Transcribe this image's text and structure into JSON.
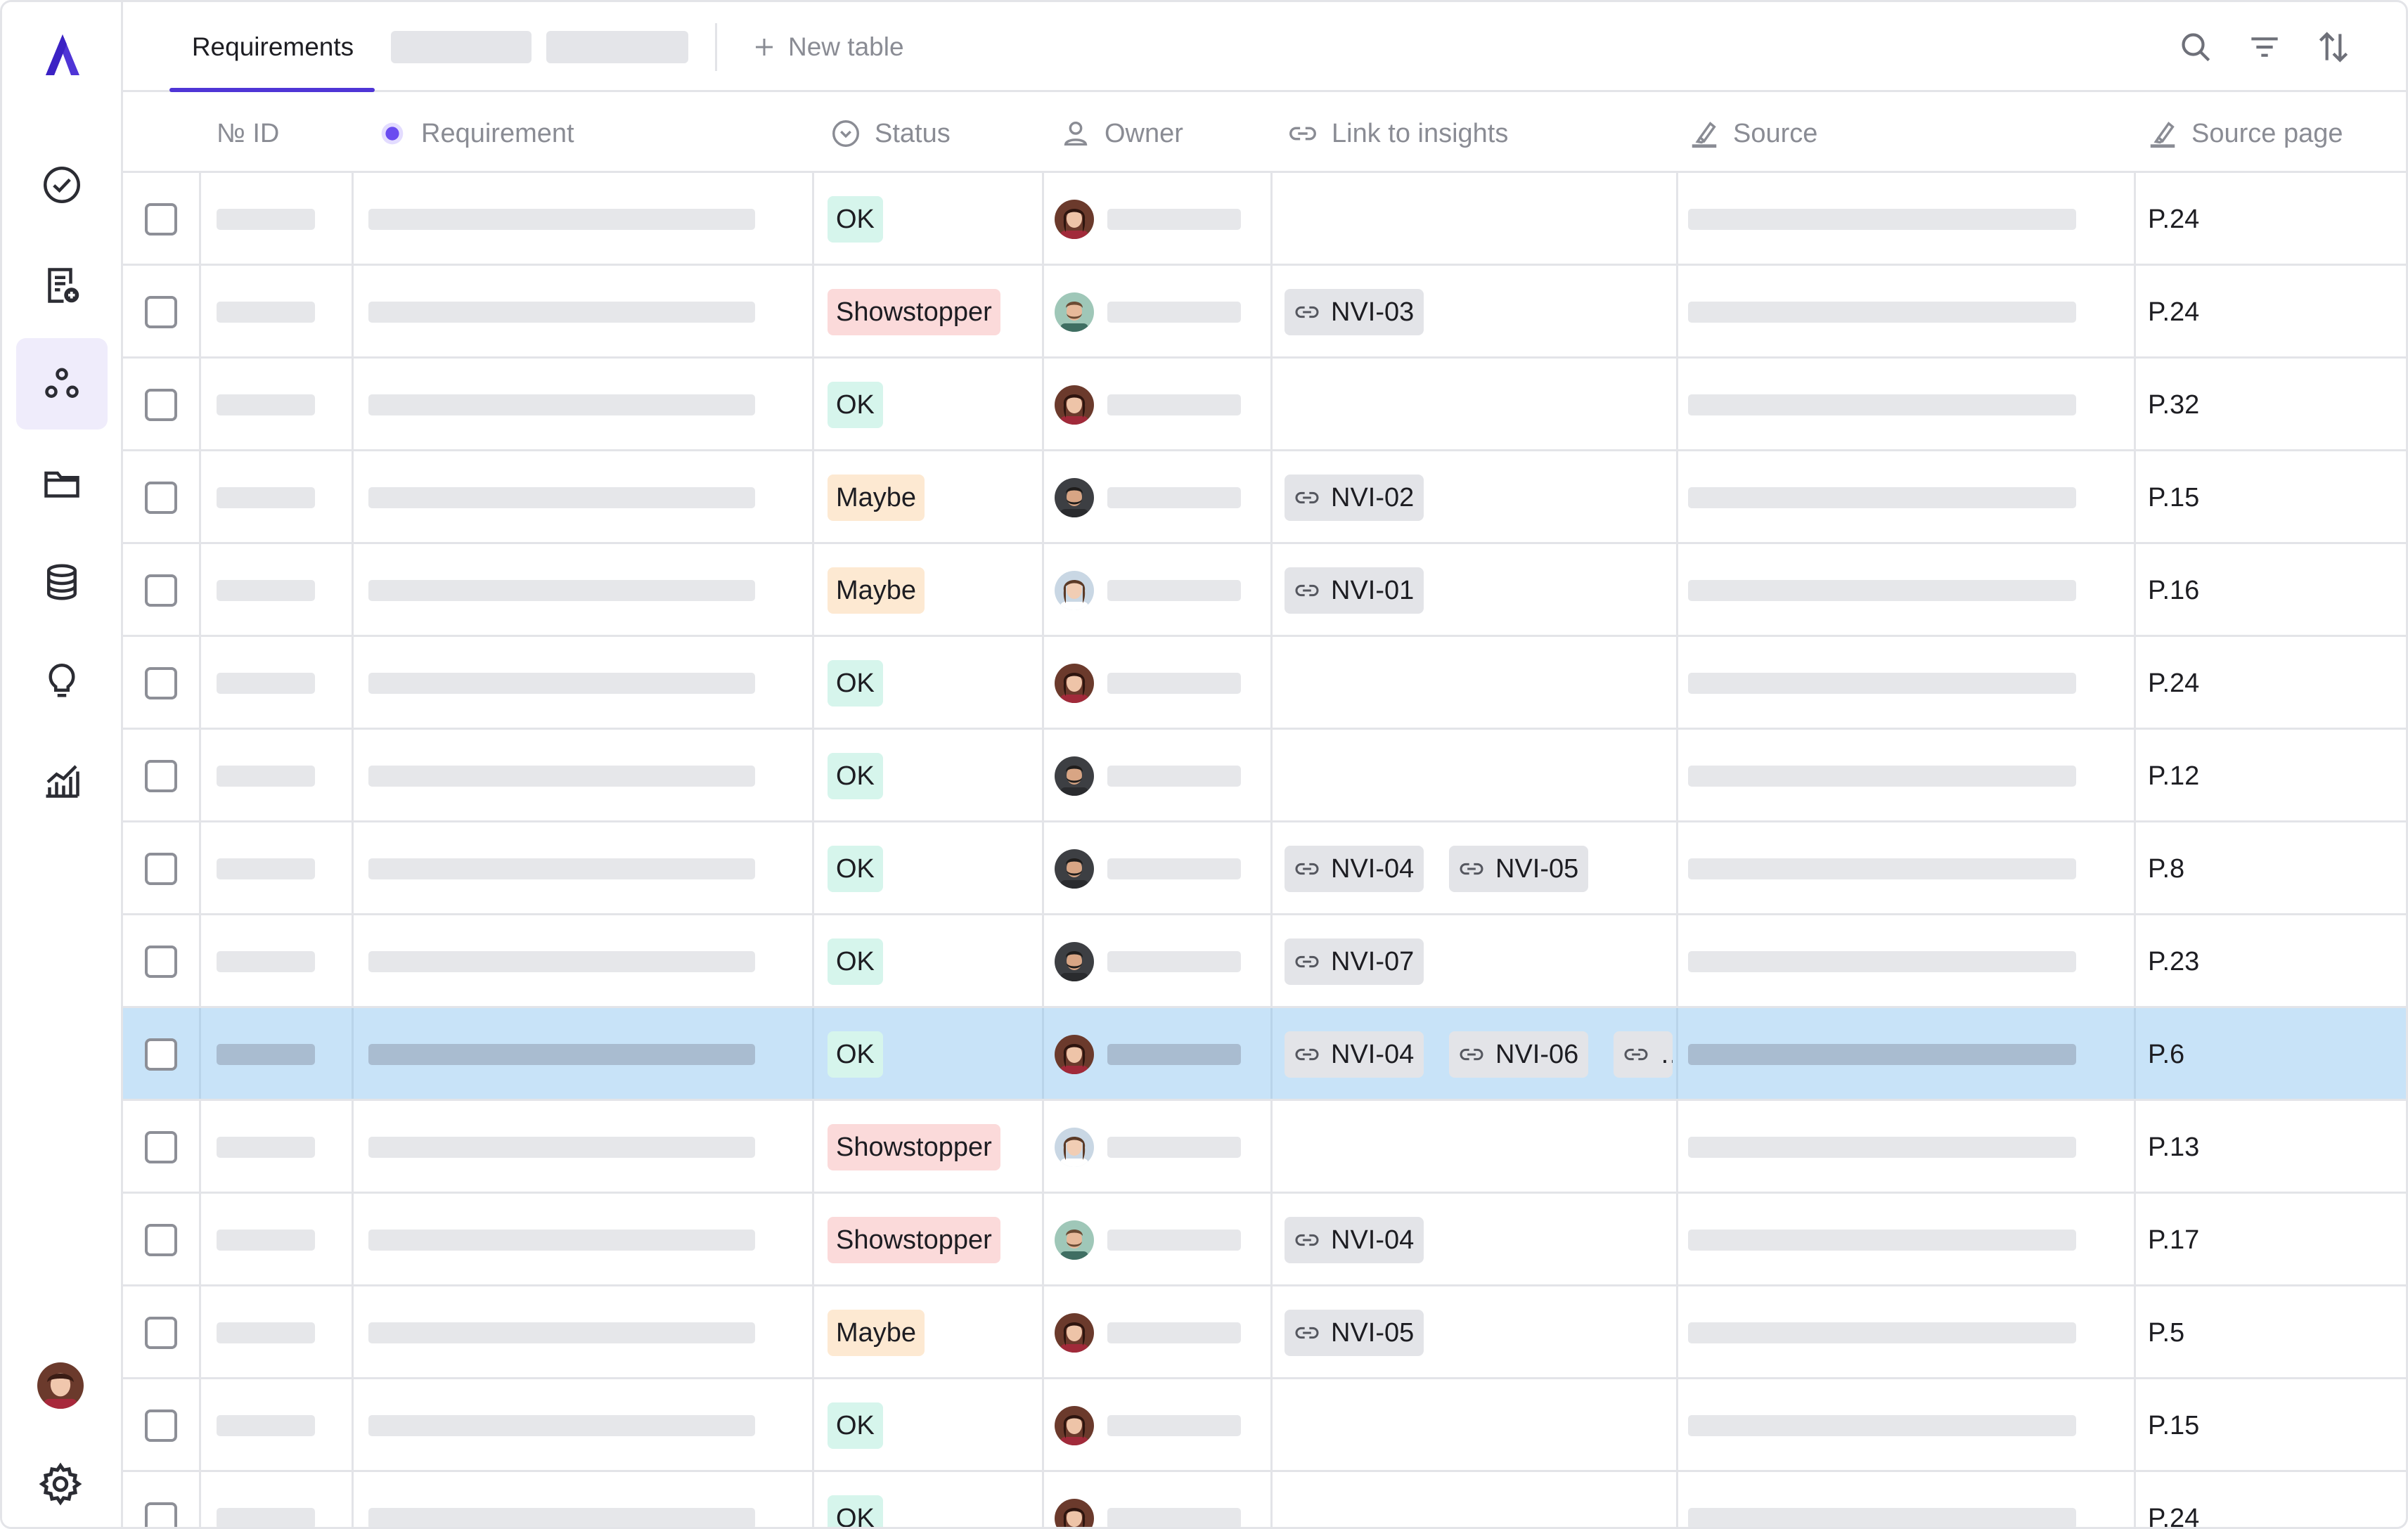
{
  "tabs": {
    "active_label": "Requirements",
    "new_table_label": "New table"
  },
  "columns": {
    "id": "№ ID",
    "requirement": "Requirement",
    "status": "Status",
    "owner": "Owner",
    "link_to_insights": "Link to insights",
    "source": "Source",
    "source_page": "Source page"
  },
  "sidebar": {
    "items": [
      {
        "icon": "check-circle-icon"
      },
      {
        "icon": "document-add-icon"
      },
      {
        "icon": "nodes-icon",
        "active": true
      },
      {
        "icon": "folder-icon"
      },
      {
        "icon": "database-icon"
      },
      {
        "icon": "lightbulb-icon"
      },
      {
        "icon": "analytics-icon"
      }
    ]
  },
  "colors": {
    "accent": "#4f35d6",
    "selected_row": "#c8e3f8",
    "ok": "#d6f5ec",
    "showstopper": "#fbdada",
    "maybe": "#fde9d2"
  },
  "rows": [
    {
      "status": "OK",
      "status_kind": "ok",
      "owner": "woman-dark",
      "insights": [],
      "page": "P.24"
    },
    {
      "status": "Showstopper",
      "status_kind": "showstopper",
      "owner": "man-teal",
      "insights": [
        "NVI-03"
      ],
      "page": "P.24"
    },
    {
      "status": "OK",
      "status_kind": "ok",
      "owner": "woman-dark",
      "insights": [],
      "page": "P.32"
    },
    {
      "status": "Maybe",
      "status_kind": "maybe",
      "owner": "man-beard",
      "insights": [
        "NVI-02"
      ],
      "page": "P.15"
    },
    {
      "status": "Maybe",
      "status_kind": "maybe",
      "owner": "woman-light",
      "insights": [
        "NVI-01"
      ],
      "page": "P.16"
    },
    {
      "status": "OK",
      "status_kind": "ok",
      "owner": "woman-dark",
      "insights": [],
      "page": "P.24"
    },
    {
      "status": "OK",
      "status_kind": "ok",
      "owner": "man-beard",
      "insights": [],
      "page": "P.12"
    },
    {
      "status": "OK",
      "status_kind": "ok",
      "owner": "man-beard",
      "insights": [
        "NVI-04",
        "NVI-05"
      ],
      "page": "P.8"
    },
    {
      "status": "OK",
      "status_kind": "ok",
      "owner": "man-beard",
      "insights": [
        "NVI-07"
      ],
      "page": "P.23"
    },
    {
      "status": "OK",
      "status_kind": "ok",
      "owner": "woman-dark",
      "insights": [
        "NVI-04",
        "NVI-06",
        "…"
      ],
      "page": "P.6",
      "selected": true
    },
    {
      "status": "Showstopper",
      "status_kind": "showstopper",
      "owner": "woman-light",
      "insights": [],
      "page": "P.13"
    },
    {
      "status": "Showstopper",
      "status_kind": "showstopper",
      "owner": "man-teal",
      "insights": [
        "NVI-04"
      ],
      "page": "P.17"
    },
    {
      "status": "Maybe",
      "status_kind": "maybe",
      "owner": "woman-dark",
      "insights": [
        "NVI-05"
      ],
      "page": "P.5"
    },
    {
      "status": "OK",
      "status_kind": "ok",
      "owner": "woman-dark",
      "insights": [],
      "page": "P.15"
    },
    {
      "status": "OK",
      "status_kind": "ok",
      "owner": "woman-dark",
      "insights": [],
      "page": "P.24"
    }
  ]
}
